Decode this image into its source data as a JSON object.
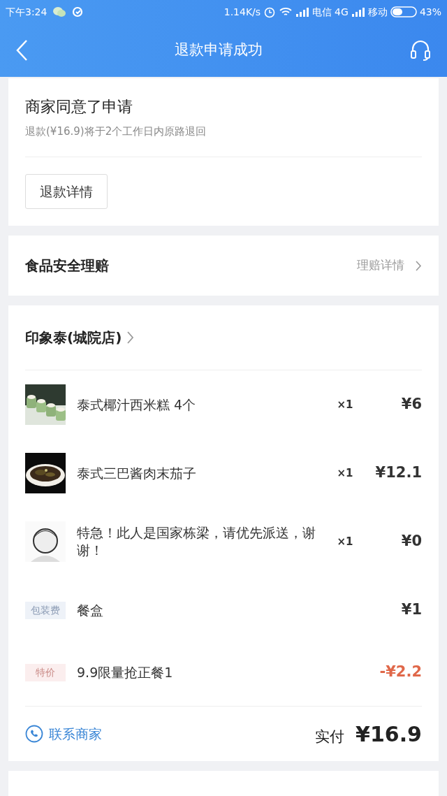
{
  "status_bar": {
    "time": "下午3:24",
    "speed": "1.14K/s",
    "carrier_1": "电信",
    "network": "4G",
    "carrier_2": "移动",
    "battery": "43%"
  },
  "header": {
    "title": "退款申请成功"
  },
  "refund": {
    "title": "商家同意了申请",
    "subtitle": "退款(¥16.9)将于2个工作日内原路退回",
    "button": "退款详情"
  },
  "insurance": {
    "title": "食品安全理赔",
    "link": "理赔详情"
  },
  "order": {
    "shop": "印象泰(城院店)",
    "items": [
      {
        "kind": "dish",
        "name": "泰式椰汁西米糕 4个",
        "qty": "×1",
        "price": "¥6"
      },
      {
        "kind": "dish",
        "name": "泰式三巴酱肉末茄子",
        "qty": "×1",
        "price": "¥12.1"
      },
      {
        "kind": "dish",
        "name": "特急！此人是国家栋梁，请优先派送，谢谢！",
        "qty": "×1",
        "price": "¥0"
      },
      {
        "kind": "fee",
        "tag": "包装费",
        "name": "餐盒",
        "price": "¥1"
      },
      {
        "kind": "discount",
        "tag": "特价",
        "name": "9.9限量抢正餐1",
        "price": "-¥2.2"
      }
    ],
    "contact": "联系商家",
    "paid_label": "实付",
    "paid": "¥16.9"
  }
}
